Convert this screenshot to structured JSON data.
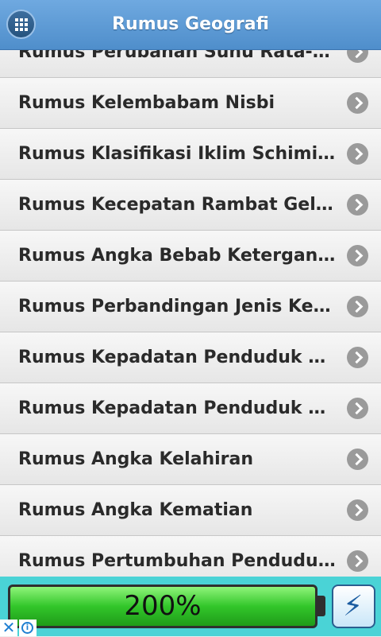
{
  "header": {
    "title": "Rumus Geografi",
    "menu_icon": "grid-icon"
  },
  "list": {
    "items": [
      "Rumus Perubahan Suhu Rata-Rata ...",
      "Rumus Kelembabam Nisbi",
      "Rumus Klasifikasi Iklim Schimidt F...",
      "Rumus Kecepatan Rambat Gelomb...",
      "Rumus Angka Bebab Ketergantung...",
      "Rumus Perbandingan Jenis Kelami...",
      "Rumus Kepadatan Penduduk Aritm...",
      "Rumus Kepadatan Penduduk Agraris",
      "Rumus Angka Kelahiran",
      "Rumus Angka Kematian",
      "Rumus Pertumbuhan Penduduk Al..."
    ],
    "chevron_icon": "chevron-right-icon"
  },
  "ad": {
    "battery_text": "200%"
  },
  "colors": {
    "header": "#5b9bd5",
    "ad_background": "#4ad3d6",
    "battery_fill": "#32c62a"
  }
}
